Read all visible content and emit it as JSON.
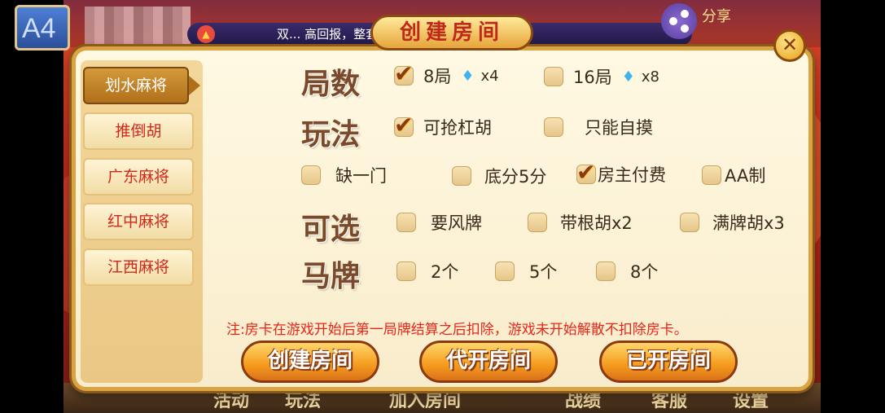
{
  "background": {
    "avatar_label": "A4",
    "marquee_text": "双...  高回报，整套完整软件，改名",
    "share_label": "分享",
    "bottom_tabs": [
      "活动",
      "玩法",
      "加入房间",
      "战绩",
      "客服",
      "设置"
    ]
  },
  "dialog": {
    "title": "创建房间",
    "close_label": "✕",
    "sidebar": [
      {
        "label": "划水麻将",
        "active": true
      },
      {
        "label": "推倒胡",
        "active": false
      },
      {
        "label": "广东麻将",
        "active": false
      },
      {
        "label": "红中麻将",
        "active": false
      },
      {
        "label": "江西麻将",
        "active": false
      }
    ],
    "rounds": {
      "title": "局数",
      "options": [
        {
          "label": "8局",
          "cost": "x4",
          "checked": true
        },
        {
          "label": "16局",
          "cost": "x8",
          "checked": false
        }
      ]
    },
    "gameplay": {
      "title": "玩法",
      "options": [
        {
          "label": "可抢杠胡",
          "checked": true
        },
        {
          "label": "只能自摸",
          "checked": false
        }
      ]
    },
    "extra": {
      "options": [
        {
          "label": "缺一门",
          "checked": false
        },
        {
          "label": "底分5分",
          "checked": false
        },
        {
          "label": "房主付费",
          "checked": true
        },
        {
          "label": "AA制",
          "checked": false
        }
      ]
    },
    "optional": {
      "title": "可选",
      "options": [
        {
          "label": "要风牌",
          "checked": false
        },
        {
          "label": "带根胡x2",
          "checked": false
        },
        {
          "label": "满牌胡x3",
          "checked": false
        }
      ]
    },
    "horse": {
      "title": "马牌",
      "options": [
        {
          "label": "2个",
          "checked": false
        },
        {
          "label": "5个",
          "checked": false
        },
        {
          "label": "8个",
          "checked": false
        }
      ]
    },
    "note": "注:房卡在游戏开始后第一局牌结算之后扣除，游戏未开始解散不扣除房卡。",
    "buttons": {
      "create": "创建房间",
      "proxy": "代开房间",
      "opened": "已开房间"
    }
  },
  "colors": {
    "accent_red": "#e6261a",
    "gold": "#d9a441",
    "diamond": "#3fb3f0"
  }
}
